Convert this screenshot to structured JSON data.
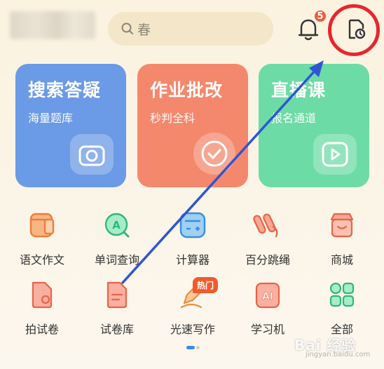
{
  "header": {
    "search_placeholder": "春",
    "notification_count": "5"
  },
  "cards": [
    {
      "title": "搜索答疑",
      "subtitle": "海量题库",
      "icon": "camera-icon"
    },
    {
      "title": "作业批改",
      "subtitle": "秒判全科",
      "icon": "check-icon"
    },
    {
      "title": "直播课",
      "subtitle": "报名通道",
      "icon": "play-icon"
    }
  ],
  "grid": [
    {
      "label": "语文作文",
      "icon": "notebook-icon"
    },
    {
      "label": "单词查询",
      "icon": "word-search-icon"
    },
    {
      "label": "计算器",
      "icon": "calculator-icon"
    },
    {
      "label": "百分跳绳",
      "icon": "jump-rope-icon"
    },
    {
      "label": "商城",
      "icon": "shop-icon"
    },
    {
      "label": "拍试卷",
      "icon": "scan-paper-icon"
    },
    {
      "label": "试卷库",
      "icon": "paper-library-icon"
    },
    {
      "label": "光速写作",
      "icon": "pen-icon"
    },
    {
      "label": "学习机",
      "icon": "ai-device-icon"
    },
    {
      "label": "全部",
      "icon": "grid-icon"
    }
  ],
  "hot_tag": "热门",
  "watermark": "Bai 经验",
  "watermark_sub": "jingyan.baidu.com",
  "colors": {
    "accent_blue": "#6b9ae6",
    "accent_orange": "#f4886c",
    "accent_green": "#6ddba5",
    "highlight_red": "#e8262d",
    "arrow_blue": "#2f55d4"
  }
}
